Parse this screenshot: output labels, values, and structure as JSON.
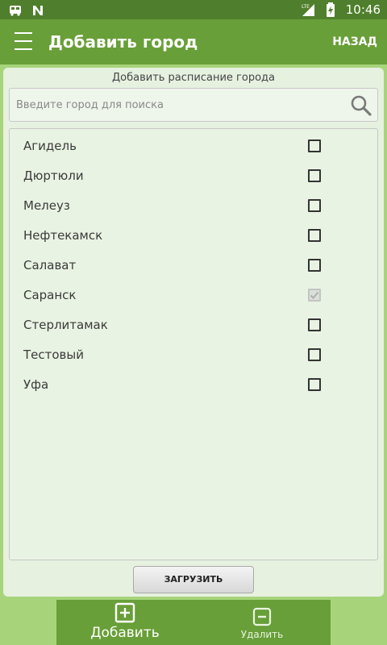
{
  "status_bar": {
    "time": "10:46",
    "icons": [
      "bus-icon",
      "n-notification-icon",
      "lte-signal-icon",
      "battery-charging-icon"
    ],
    "network_label": "LTE"
  },
  "app_bar": {
    "title": "Добавить город",
    "back_label": "НАЗАД"
  },
  "card": {
    "title": "Добавить  расписание города"
  },
  "search": {
    "placeholder": "Введите город для поиска",
    "value": ""
  },
  "cities": [
    {
      "name": "Агидель",
      "checked": false
    },
    {
      "name": "Дюртюли",
      "checked": false
    },
    {
      "name": "Мелеуз",
      "checked": false
    },
    {
      "name": "Нефтекамск",
      "checked": false
    },
    {
      "name": "Салават",
      "checked": false
    },
    {
      "name": "Саранск",
      "checked": true
    },
    {
      "name": "Стерлитамак",
      "checked": false
    },
    {
      "name": "Тестовый",
      "checked": false
    },
    {
      "name": "Уфа",
      "checked": false
    }
  ],
  "load_button": "ЗАГРУЗИТЬ",
  "bottom_nav": {
    "add_label": "Добавить",
    "delete_label": "Удалить"
  },
  "colors": {
    "primary": "#689f38",
    "primary_dark": "#4f7f2c",
    "background": "#a7d47a",
    "card": "#e6f1e0"
  }
}
